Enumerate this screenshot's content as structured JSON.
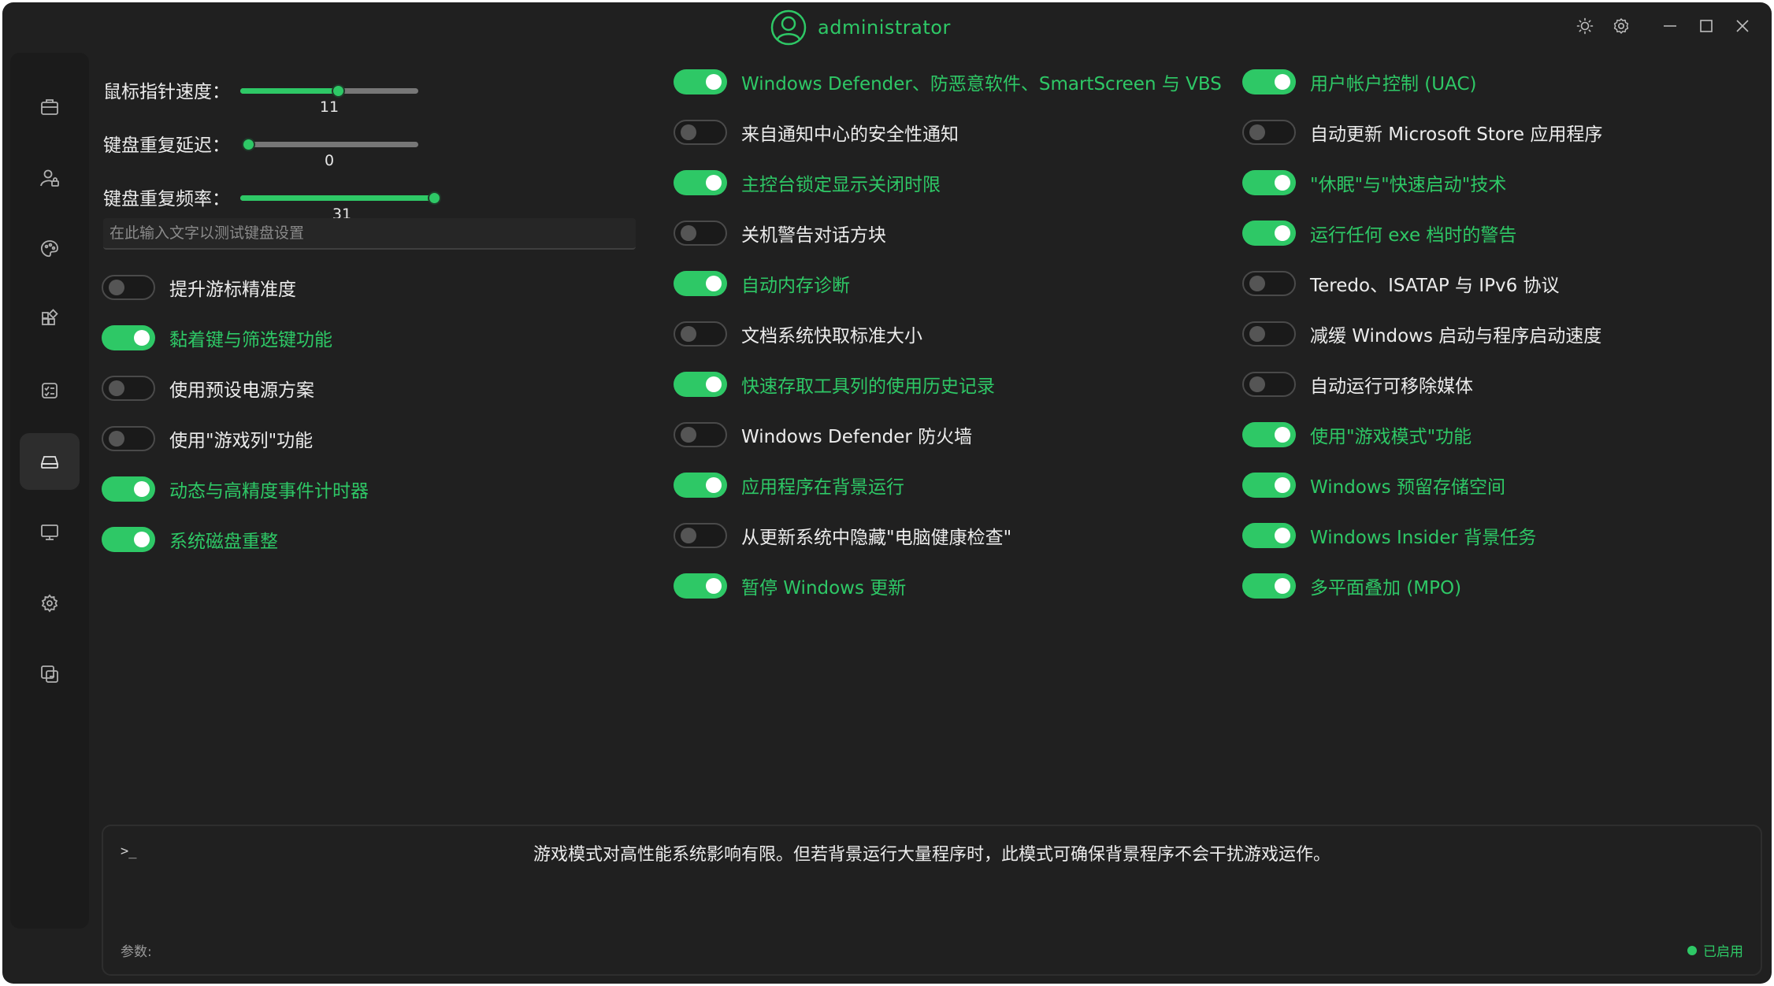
{
  "colors": {
    "accent": "#2ec866",
    "background": "#202020",
    "sidebar": "#1b1b1b",
    "toggle_off": "#555555"
  },
  "titlebar": {
    "username": "administrator",
    "icons": [
      "user-avatar-icon",
      "brightness-icon",
      "settings-icon",
      "minimize-icon",
      "maximize-icon",
      "close-icon"
    ]
  },
  "sidebar": {
    "active_index": 5,
    "items": [
      {
        "icon": "toolbox-icon"
      },
      {
        "icon": "user-lock-icon"
      },
      {
        "icon": "palette-icon"
      },
      {
        "icon": "apps-grid-icon"
      },
      {
        "icon": "checklist-icon"
      },
      {
        "icon": "drive-icon"
      },
      {
        "icon": "monitor-icon"
      },
      {
        "icon": "gear-puzzle-icon"
      },
      {
        "icon": "multi-window-icon"
      }
    ]
  },
  "sliders": [
    {
      "label": "鼠标指针速度：",
      "value": "11",
      "fraction": 0.55
    },
    {
      "label": "键盘重复延迟：",
      "value": "0",
      "fraction": 0.0
    },
    {
      "label": "键盘重复频率：",
      "value": "31",
      "fraction": 1.0
    }
  ],
  "keyboard_test": {
    "placeholder": "在此输入文字以测试键盘设置"
  },
  "col1_toggles": [
    {
      "label": "提升游标精准度",
      "on": false
    },
    {
      "label": "黏着键与筛选键功能",
      "on": true
    },
    {
      "label": "使用预设电源方案",
      "on": false
    },
    {
      "label": "使用\"游戏列\"功能",
      "on": false
    },
    {
      "label": "动态与高精度事件计时器",
      "on": true
    },
    {
      "label": "系统磁盘重整",
      "on": true
    }
  ],
  "col2_toggles": [
    {
      "label": "Windows Defender、防恶意软件、SmartScreen 与 VBS",
      "on": true
    },
    {
      "label": "来自通知中心的安全性通知",
      "on": false
    },
    {
      "label": "主控台锁定显示关闭时限",
      "on": true
    },
    {
      "label": "关机警告对话方块",
      "on": false
    },
    {
      "label": "自动内存诊断",
      "on": true
    },
    {
      "label": "文档系统快取标准大小",
      "on": false
    },
    {
      "label": "快速存取工具列的使用历史记录",
      "on": true
    },
    {
      "label": "Windows Defender 防火墙",
      "on": false
    },
    {
      "label": "应用程序在背景运行",
      "on": true
    },
    {
      "label": "从更新系统中隐藏\"电脑健康检查\"",
      "on": false
    },
    {
      "label": "暂停 Windows 更新",
      "on": true
    }
  ],
  "col3_toggles": [
    {
      "label": "用户帐户控制 (UAC)",
      "on": true
    },
    {
      "label": "自动更新 Microsoft Store 应用程序",
      "on": false
    },
    {
      "label": "\"休眠\"与\"快速启动\"技术",
      "on": true
    },
    {
      "label": "运行任何 exe 档时的警告",
      "on": true
    },
    {
      "label": "Teredo、ISATAP 与 IPv6 协议",
      "on": false
    },
    {
      "label": "减缓 Windows 启动与程序启动速度",
      "on": false
    },
    {
      "label": "自动运行可移除媒体",
      "on": false
    },
    {
      "label": "使用\"游戏模式\"功能",
      "on": true
    },
    {
      "label": "Windows 预留存储空间",
      "on": true
    },
    {
      "label": "Windows Insider 背景任务",
      "on": true
    },
    {
      "label": "多平面叠加 (MPO)",
      "on": true
    }
  ],
  "console": {
    "prompt": ">_",
    "message": "游戏模式对高性能系统影响有限。但若背景运行大量程序时，此模式可确保背景程序不会干扰游戏运作。",
    "params_label": "参数:",
    "status": "已启用"
  }
}
